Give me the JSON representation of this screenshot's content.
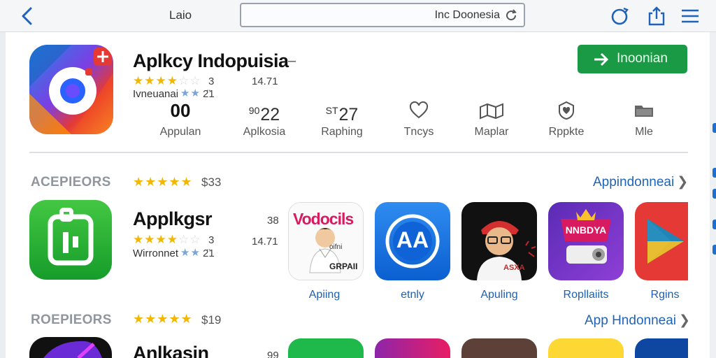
{
  "topbar": {
    "back_label": "Laio",
    "url_value": "Inc Doonesia"
  },
  "header_app": {
    "title": "Aplkcy Indopuisia",
    "dash": "–",
    "rating_count": "3",
    "size": "14.71",
    "developer": "Ivneuanai",
    "secondary_rating": "2̈1",
    "install_label": "Inoonian",
    "stats": [
      {
        "value": "00",
        "label": "Appulan"
      },
      {
        "prefix": "90",
        "value": "22",
        "label": "Aplkosia"
      },
      {
        "prefix": "ST",
        "value": "27",
        "label": "Raphing"
      },
      {
        "icon": "heart-icon",
        "label": "Tncys"
      },
      {
        "icon": "map-icon",
        "label": "Maplar"
      },
      {
        "icon": "badge-heart-icon",
        "label": "Rppkte"
      },
      {
        "icon": "folder-icon",
        "label": "Mle"
      }
    ]
  },
  "sections": [
    {
      "title": "ACEPIEORS",
      "rating_stars": "★★★★★",
      "price": "$33",
      "link": "Appindonneai",
      "app_title": "Applkgsr",
      "app_rating_count": "3",
      "app_count_top": "38",
      "app_size": "14.71",
      "app_developer": "Wirronnet",
      "app_secondary_rating": "2̈1",
      "tiles": [
        {
          "label": "Apiing",
          "art_text_top": "Vodocils",
          "art_text_bottom": "GRPAII",
          "art_text_mid": "oifni"
        },
        {
          "label": "etnly",
          "art_text": "AA"
        },
        {
          "label": "Apuling",
          "art_text": "ASXA"
        },
        {
          "label": "Ropllaiits",
          "art_text": "NNBDYA"
        },
        {
          "label": "Rgins"
        }
      ]
    },
    {
      "title": "ROEPIEORS",
      "rating_stars": "★★★★★",
      "price": "$19",
      "link": "App Hndonneai",
      "app_title": "Anlkasin",
      "app_count_top": "99"
    }
  ],
  "colors": {
    "install_green": "#1a9a45",
    "link_blue": "#1f63b8",
    "star_gold": "#f2b705"
  }
}
